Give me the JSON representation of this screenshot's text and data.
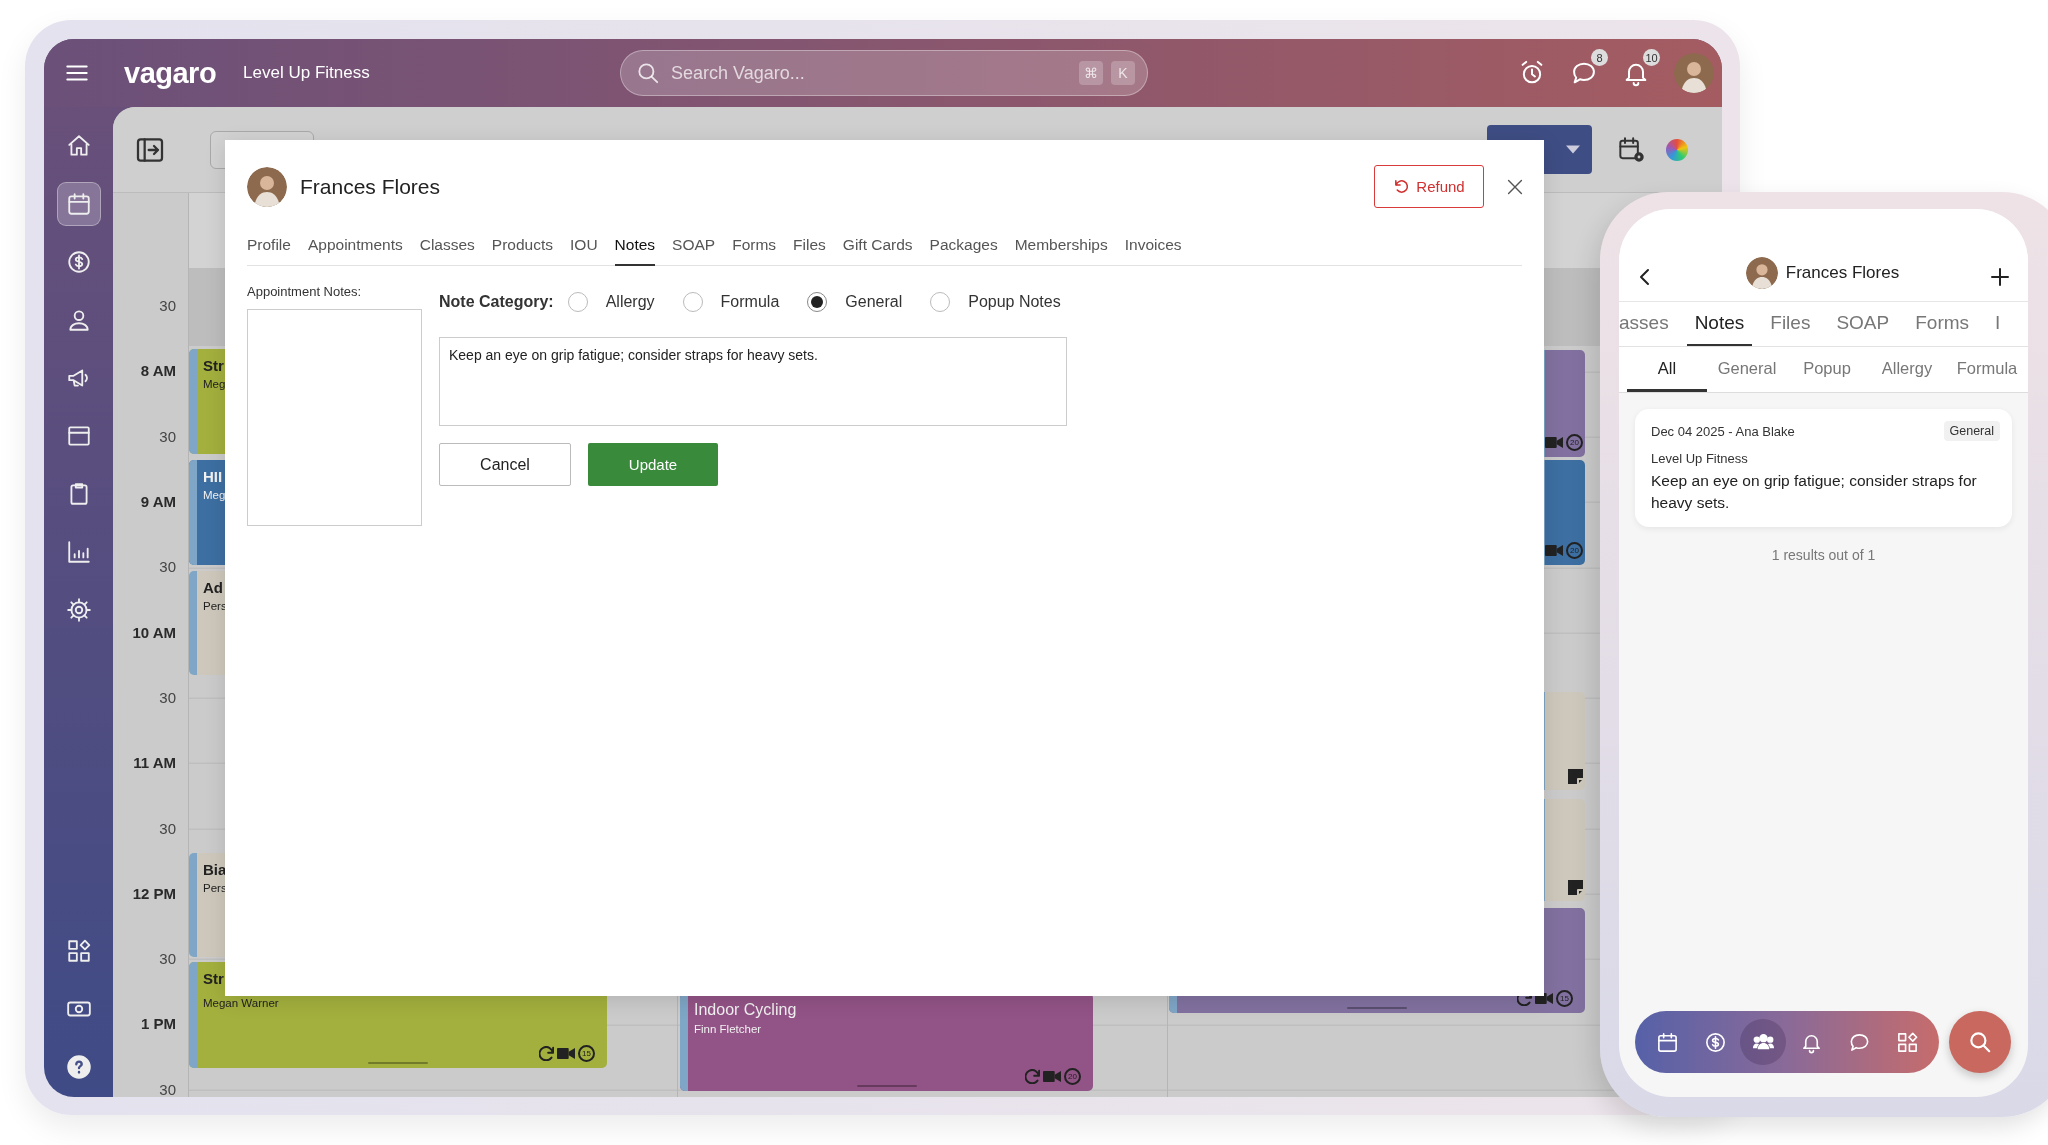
{
  "topbar": {
    "brand": "vagaro",
    "business": "Level Up Fitness",
    "search": {
      "placeholder": "Search Vagaro...",
      "keys": [
        "⌘",
        "K"
      ]
    },
    "messages_badge": "8",
    "notifications_badge": "10"
  },
  "sidebar": {
    "items": [
      {
        "kind": "home",
        "selected": false
      },
      {
        "kind": "calendar",
        "selected": true
      },
      {
        "kind": "dollar",
        "selected": false
      },
      {
        "kind": "person",
        "selected": false
      },
      {
        "kind": "megaphone",
        "selected": false
      },
      {
        "kind": "browser",
        "selected": false
      },
      {
        "kind": "clipboard",
        "selected": false
      },
      {
        "kind": "chart",
        "selected": false
      },
      {
        "kind": "settings",
        "selected": false
      }
    ],
    "bottom_items": [
      {
        "kind": "apps",
        "selected": false
      },
      {
        "kind": "money",
        "selected": false
      },
      {
        "kind": "help",
        "selected": false
      }
    ]
  },
  "calendar": {
    "times": [
      {
        "label": "30",
        "kind": "half"
      },
      {
        "label": "8 AM",
        "kind": "hour"
      },
      {
        "label": "30",
        "kind": "half"
      },
      {
        "label": "9 AM",
        "kind": "hour"
      },
      {
        "label": "30",
        "kind": "half"
      },
      {
        "label": "10 AM",
        "kind": "hour"
      },
      {
        "label": "30",
        "kind": "half"
      },
      {
        "label": "11 AM",
        "kind": "hour"
      },
      {
        "label": "30",
        "kind": "half"
      },
      {
        "label": "12 PM",
        "kind": "hour"
      },
      {
        "label": "30",
        "kind": "half"
      },
      {
        "label": "1 PM",
        "kind": "hour"
      },
      {
        "label": "30",
        "kind": "half"
      }
    ],
    "events": [
      {
        "title": "Str",
        "subtitle": "Meg",
        "color": "#a3b03d"
      },
      {
        "title": "HII",
        "subtitle": "Meg",
        "color": "#3d6fa2"
      },
      {
        "title": "Ad",
        "subtitle": "Pers",
        "color": "#cec8bc"
      },
      {
        "title": "Bia",
        "subtitle": "Pers",
        "color": "#cec8bc"
      },
      {
        "kind": "class",
        "title": "Str",
        "subtitle": "Megan Warner",
        "color": "#a3b03d",
        "timer": "15"
      },
      {
        "kind": "class",
        "title": "Indoor Cycling",
        "subtitle": "Finn Fletcher",
        "color": "#925386",
        "timer": "20"
      },
      {
        "kind": "class",
        "color": "#8271a0",
        "timer": "20"
      },
      {
        "kind": "class",
        "color": "#3d6fa2",
        "timer": "20"
      },
      {
        "kind": "appointment",
        "color": "#cec8bc"
      },
      {
        "kind": "appointment",
        "color": "#cec8bc"
      },
      {
        "kind": "class",
        "color": "#8271a0",
        "timer": "15"
      }
    ]
  },
  "dialog": {
    "client": "Frances Flores",
    "refund": "Refund",
    "tabs": [
      {
        "label": "Profile",
        "selected": false
      },
      {
        "label": "Appointments",
        "selected": false
      },
      {
        "label": "Classes",
        "selected": false
      },
      {
        "label": "Products",
        "selected": false
      },
      {
        "label": "IOU",
        "selected": false
      },
      {
        "label": "Notes",
        "selected": true
      },
      {
        "label": "SOAP",
        "selected": false
      },
      {
        "label": "Forms",
        "selected": false
      },
      {
        "label": "Files",
        "selected": false
      },
      {
        "label": "Gift Cards",
        "selected": false
      },
      {
        "label": "Packages",
        "selected": false
      },
      {
        "label": "Memberships",
        "selected": false
      },
      {
        "label": "Invoices",
        "selected": false
      }
    ],
    "appointment_notes_label": "Appointment Notes:",
    "note_category_label": "Note Category:",
    "categories": [
      {
        "label": "Allergy",
        "selected": false
      },
      {
        "label": "Formula",
        "selected": false
      },
      {
        "label": "General",
        "selected": true
      },
      {
        "label": "Popup Notes",
        "selected": false
      }
    ],
    "note": "Keep an eye on grip fatigue; consider straps for heavy sets.",
    "cancel": "Cancel",
    "update": "Update"
  },
  "phone": {
    "client": "Frances Flores",
    "tabs": [
      {
        "label": "asses",
        "selected": false
      },
      {
        "label": "Notes",
        "selected": true
      },
      {
        "label": "Files",
        "selected": false
      },
      {
        "label": "SOAP",
        "selected": false
      },
      {
        "label": "Forms",
        "selected": false
      },
      {
        "label": "I",
        "selected": false
      }
    ],
    "filters": [
      {
        "label": "All",
        "selected": true
      },
      {
        "label": "General",
        "selected": false
      },
      {
        "label": "Popup",
        "selected": false
      },
      {
        "label": "Allergy",
        "selected": false
      },
      {
        "label": "Formula",
        "selected": false
      }
    ],
    "note_card": {
      "meta": "Dec 04 2025 - Ana Blake",
      "tag": "General",
      "business": "Level Up Fitness",
      "text": "Keep an eye on grip fatigue; consider straps for heavy sets."
    },
    "results": "1 results out of 1",
    "nav": [
      {
        "kind": "calendar",
        "selected": false
      },
      {
        "kind": "dollar",
        "selected": false
      },
      {
        "kind": "people",
        "selected": true
      },
      {
        "kind": "bell",
        "selected": false
      },
      {
        "kind": "chat",
        "selected": false
      },
      {
        "kind": "apps",
        "selected": false
      }
    ]
  }
}
